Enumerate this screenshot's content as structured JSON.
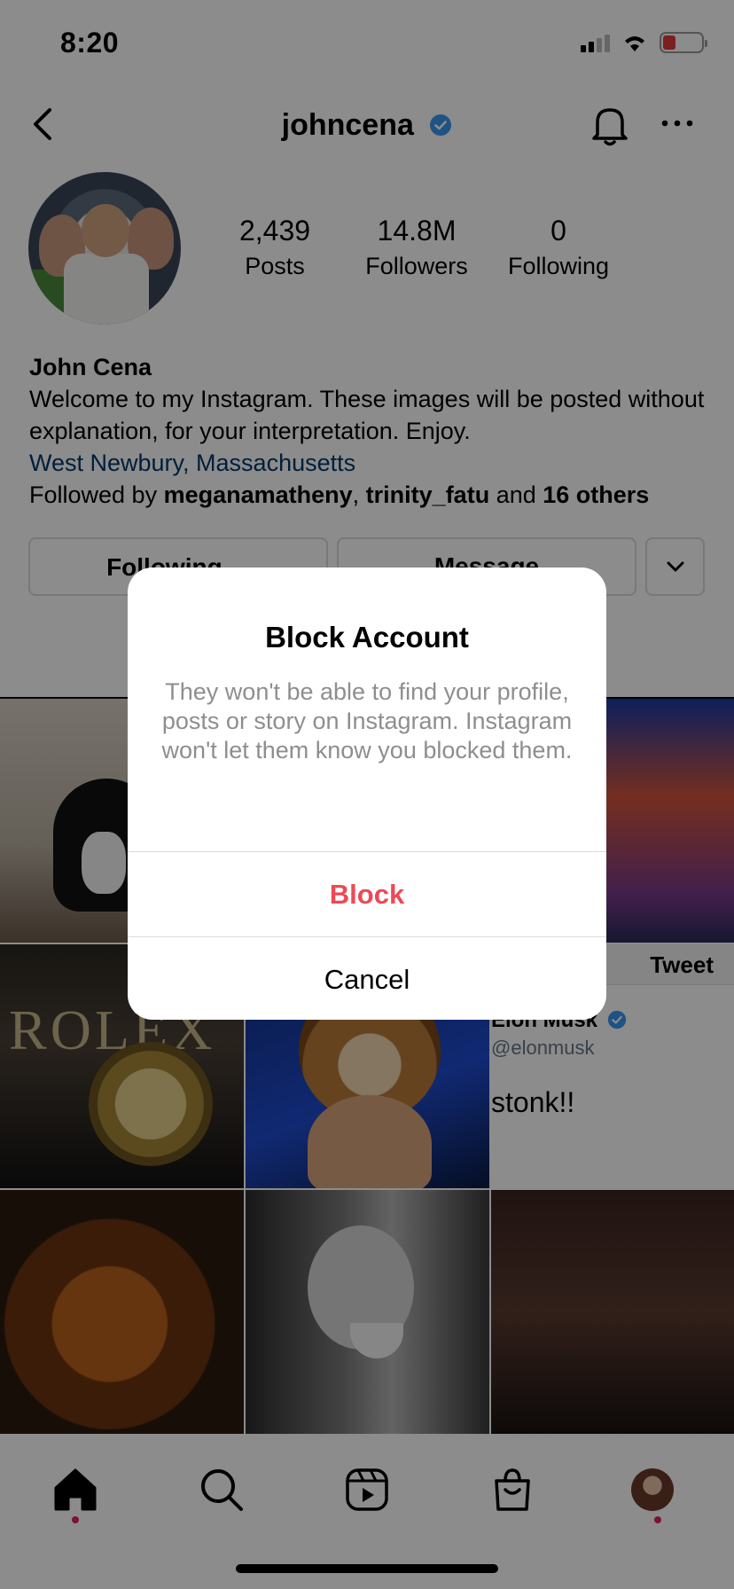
{
  "status_bar": {
    "time": "8:20"
  },
  "header": {
    "username": "johncena",
    "icons": [
      "back-icon",
      "verified-icon",
      "bell-icon",
      "more-icon"
    ]
  },
  "profile": {
    "stats": [
      {
        "value": "2,439",
        "label": "Posts"
      },
      {
        "value": "14.8M",
        "label": "Followers"
      },
      {
        "value": "0",
        "label": "Following"
      }
    ],
    "name": "John Cena",
    "bio": "Welcome to my Instagram. These images will be posted without explanation, for your interpretation. Enjoy.",
    "location": "West Newbury, Massachusetts",
    "followed_by_prefix": "Followed by ",
    "followed_by_user1": "meganamatheny",
    "followed_by_sep": ", ",
    "followed_by_user2": "trinity_fatu",
    "followed_by_and": " and ",
    "followed_by_others": "16 others"
  },
  "actions": {
    "following_label": "Following ⌄",
    "message_label": "Message"
  },
  "grid": {
    "rolex_text": "ROLEX",
    "tweet": {
      "button": "Tweet",
      "author": "Elon Musk",
      "handle": "@elonmusk",
      "text": "stonk!!"
    }
  },
  "tabbar": {
    "icons": [
      "home-icon",
      "search-icon",
      "reels-icon",
      "shop-icon",
      "profile-icon"
    ]
  },
  "dialog": {
    "title": "Block Account",
    "message": "They won't be able to find your profile, posts or story on Instagram. Instagram won't let them know you blocked them.",
    "block_label": "Block",
    "cancel_label": "Cancel"
  },
  "colors": {
    "accent_blue": "#3897f0",
    "block_red": "#ed4956",
    "link": "#00376b"
  }
}
